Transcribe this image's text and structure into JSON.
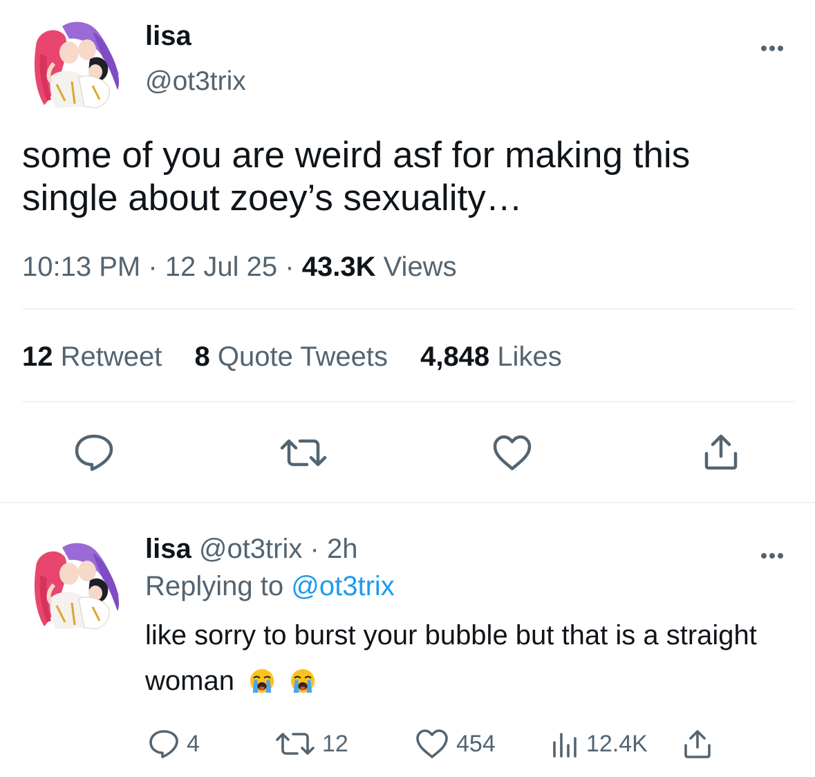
{
  "tweet": {
    "author_name": "lisa",
    "author_handle": "@ot3trix",
    "text": "some of you are weird asf for making this single about zoey’s sexuality…",
    "time": "10:13 PM",
    "separator": "·",
    "date": "12 Jul 25",
    "views_count": "43.3K",
    "views_label": "Views",
    "stats": {
      "retweets_count": "12",
      "retweets_label": "Retweet",
      "quotes_count": "8",
      "quotes_label": "Quote Tweets",
      "likes_count": "4,848",
      "likes_label": "Likes"
    },
    "actions": [
      "reply-icon",
      "retweet-icon",
      "like-icon",
      "share-icon"
    ]
  },
  "reply": {
    "author_name": "lisa",
    "author_handle": "@ot3trix",
    "separator": "·",
    "age": "2h",
    "replying_prefix": "Replying to",
    "replying_handle": "@ot3trix",
    "text": "like sorry to burst your bubble but that is a straight woman",
    "emoji": [
      "loudly-crying-face",
      "loudly-crying-face"
    ],
    "counts": {
      "replies": "4",
      "retweets": "12",
      "likes": "454",
      "views": "12.4K"
    }
  },
  "colors": {
    "text_primary": "#0f1419",
    "text_secondary": "#536471",
    "link": "#1d9bf0",
    "divider": "#eff3f4"
  }
}
